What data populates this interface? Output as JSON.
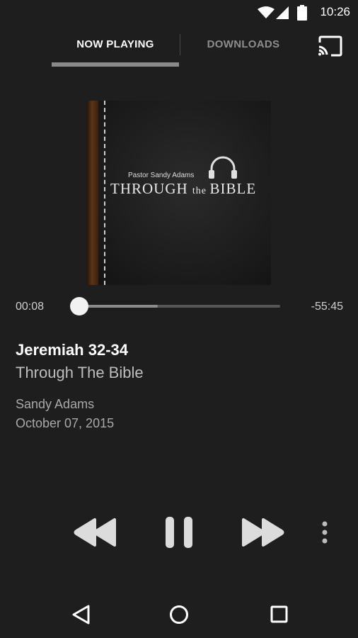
{
  "status_bar": {
    "time": "10:26",
    "icons": [
      "wifi-icon",
      "cell-signal-icon",
      "battery-icon"
    ]
  },
  "tabs": {
    "now_playing": "NOW PLAYING",
    "downloads": "DOWNLOADS",
    "active": "NOW PLAYING"
  },
  "album_art": {
    "author_line": "Pastor Sandy Adams",
    "title_big_1": "THROUGH ",
    "title_small": "the ",
    "title_big_2": "BIBLE"
  },
  "player": {
    "elapsed": "00:08",
    "remaining": "-55:45",
    "played_fraction": 0.0,
    "buffered_fraction": 0.39
  },
  "episode": {
    "title": "Jeremiah 32-34",
    "series": "Through The Bible",
    "speaker": "Sandy Adams",
    "date": "October 07, 2015"
  },
  "controls": [
    "rewind-icon",
    "pause-icon",
    "fast-forward-icon",
    "more-vert-icon"
  ],
  "nav": [
    "back-icon",
    "home-icon",
    "recents-icon"
  ],
  "colors": {
    "background": "#1e1e1e",
    "accent": "#f2f2f2",
    "muted": "#8d8d8d"
  }
}
